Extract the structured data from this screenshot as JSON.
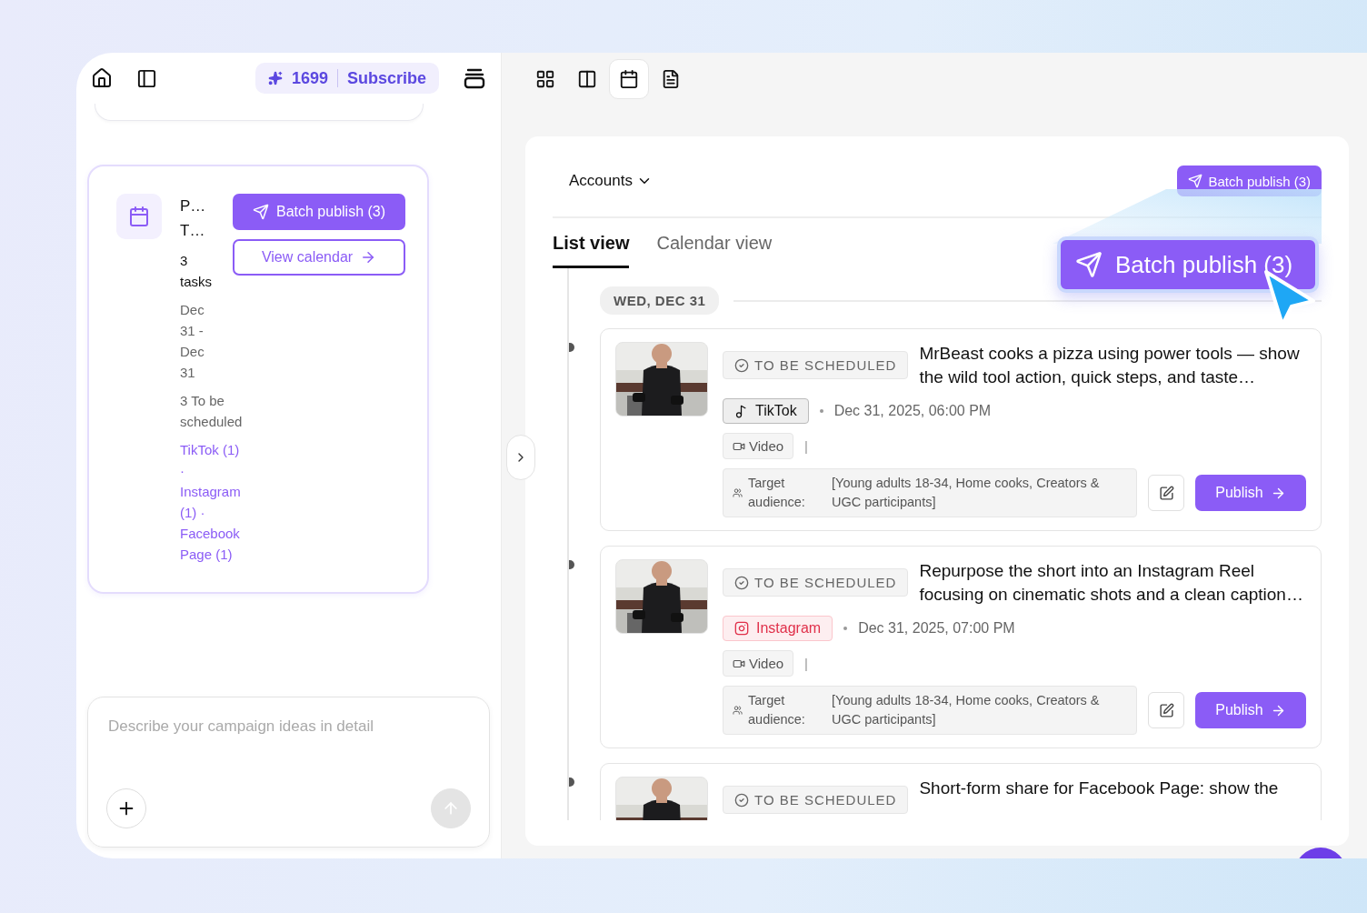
{
  "topbar": {
    "credits": "1699",
    "subscribe": "Subscribe"
  },
  "campaign": {
    "title_lines": [
      "P…",
      "T…"
    ],
    "task_count": "3 tasks",
    "date_range": "Dec 31 - Dec 31",
    "status": "3 To be scheduled",
    "platforms": "TikTok (1) · Instagram (1) · Facebook Page (1)",
    "batch_publish": "Batch publish (3)",
    "view_calendar": "View calendar"
  },
  "composer": {
    "placeholder": "Describe your campaign ideas in detail"
  },
  "view_toolbar": [
    {
      "kind": "grid",
      "selected": false
    },
    {
      "kind": "split",
      "selected": false
    },
    {
      "kind": "calendar",
      "selected": true
    },
    {
      "kind": "document",
      "selected": false
    }
  ],
  "panel": {
    "accounts": "Accounts",
    "batch_publish": "Batch publish (3)",
    "tabs": [
      {
        "label": "List view",
        "selected": true
      },
      {
        "label": "Calendar view",
        "selected": false
      }
    ],
    "highlight": "Batch publish (3)",
    "date": "WED, DEC 31",
    "posts": [
      {
        "status": "TO BE SCHEDULED",
        "title": "MrBeast cooks a pizza using power tools — show the wild tool action, quick steps, and taste…",
        "platform": {
          "kind": "tiktok",
          "label": "TikTok"
        },
        "time": "Dec 31, 2025, 06:00 PM",
        "media": "Video",
        "separator": "|",
        "audience_label": "Target audience:",
        "audience": "[Young adults 18-34, Home cooks, Creators & UGC participants]",
        "publish": "Publish"
      },
      {
        "status": "TO BE SCHEDULED",
        "title": "Repurpose the short into an Instagram Reel focusing on cinematic shots and a clean caption…",
        "platform": {
          "kind": "instagram",
          "label": "Instagram"
        },
        "time": "Dec 31, 2025, 07:00 PM",
        "media": "Video",
        "separator": "|",
        "audience_label": "Target audience:",
        "audience": "[Young adults 18-34, Home cooks, Creators & UGC participants]",
        "publish": "Publish"
      },
      {
        "status": "TO BE SCHEDULED",
        "title": "Short-form share for Facebook Page: show the"
      }
    ]
  }
}
